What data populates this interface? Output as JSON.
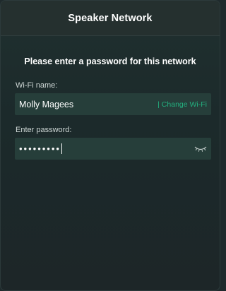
{
  "header": {
    "title": "Speaker Network"
  },
  "prompt": "Please enter a password for this network",
  "wifi": {
    "label": "Wi-Fi name:",
    "name": "Molly Magees",
    "change_link": "| Change Wi-Fi"
  },
  "password": {
    "label": "Enter password:",
    "masked_value": "•••••••••",
    "toggle_icon": "eye-closed-icon"
  },
  "colors": {
    "accent": "#23b07f",
    "background": "#1f2a2c",
    "field": "#263e3a"
  }
}
